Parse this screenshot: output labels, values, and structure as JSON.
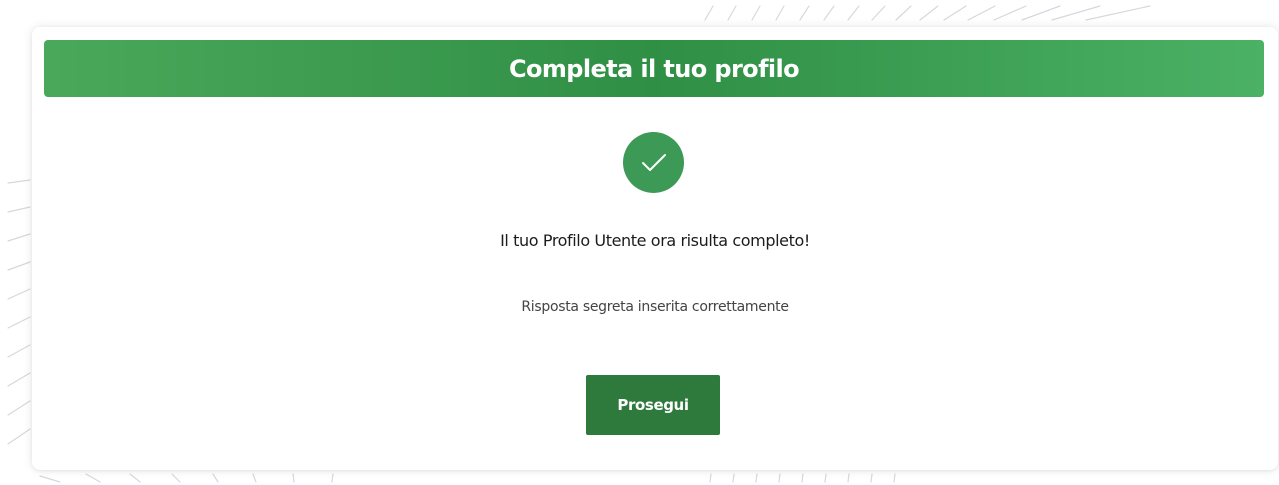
{
  "card": {
    "title": "Completa il tuo profilo",
    "status_icon": "check-icon",
    "success_message": "Il tuo Profilo Utente ora risulta completo!",
    "detail_message": "Risposta segreta inserita correttamente",
    "continue_button_label": "Prosegui"
  },
  "colors": {
    "header_green": "#3a9b50",
    "check_circle_green": "#3c9a56",
    "button_green": "#2d7a3c",
    "decorative_lines": "#d3d9de"
  }
}
